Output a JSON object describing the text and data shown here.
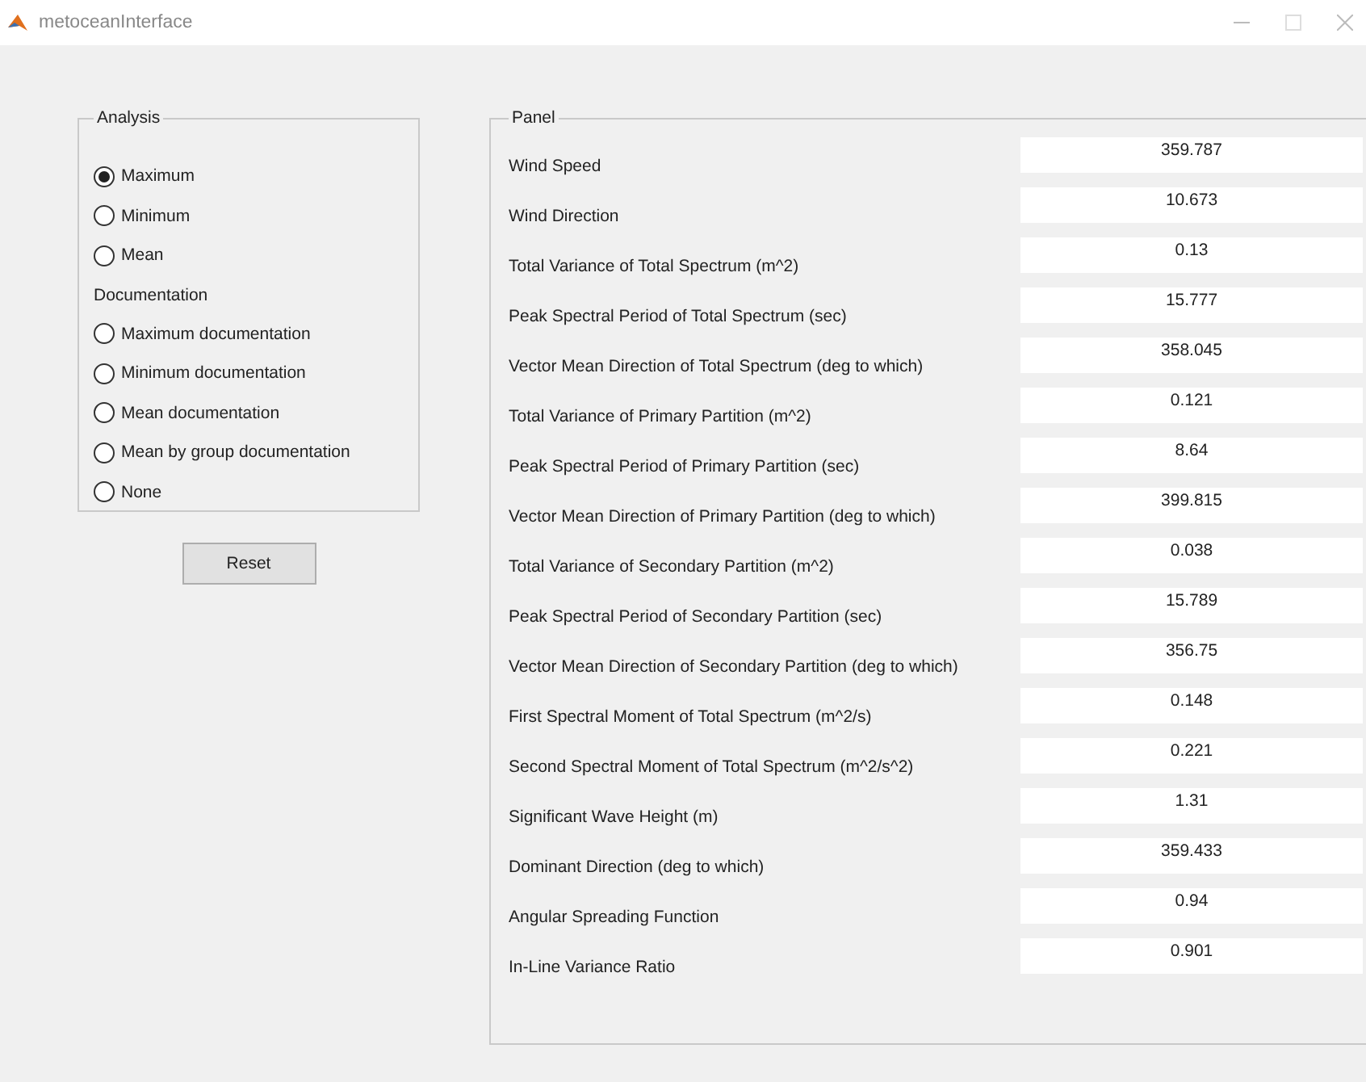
{
  "window": {
    "title": "metoceanInterface"
  },
  "analysis": {
    "title": "Analysis",
    "items": [
      {
        "kind": "radio",
        "label": "Maximum",
        "selected": true
      },
      {
        "kind": "radio",
        "label": "Minimum",
        "selected": false
      },
      {
        "kind": "radio",
        "label": "Mean",
        "selected": false
      },
      {
        "kind": "heading",
        "label": "Documentation"
      },
      {
        "kind": "radio",
        "label": "Maximum documentation",
        "selected": false
      },
      {
        "kind": "radio",
        "label": "Minimum documentation",
        "selected": false
      },
      {
        "kind": "radio",
        "label": "Mean documentation",
        "selected": false
      },
      {
        "kind": "radio",
        "label": "Mean by group documentation",
        "selected": false
      },
      {
        "kind": "radio",
        "label": "None",
        "selected": false
      }
    ]
  },
  "reset_button": "Reset",
  "panel": {
    "title": "Panel",
    "rows": [
      {
        "label": "Wind Speed",
        "value": "359.787"
      },
      {
        "label": "Wind Direction",
        "value": "10.673"
      },
      {
        "label": "Total Variance of Total Spectrum (m^2)",
        "value": "0.13"
      },
      {
        "label": "Peak Spectral Period of Total Spectrum (sec)",
        "value": "15.777"
      },
      {
        "label": "Vector Mean Direction of Total Spectrum (deg to which)",
        "value": "358.045"
      },
      {
        "label": "Total Variance of Primary Partition (m^2)",
        "value": "0.121"
      },
      {
        "label": "Peak Spectral Period of Primary Partition (sec)",
        "value": "8.64"
      },
      {
        "label": "Vector Mean Direction of Primary Partition (deg to which)",
        "value": "399.815"
      },
      {
        "label": "Total Variance of Secondary Partition (m^2)",
        "value": "0.038"
      },
      {
        "label": "Peak Spectral Period of Secondary Partition (sec)",
        "value": "15.789"
      },
      {
        "label": "Vector Mean Direction of Secondary Partition (deg to which)",
        "value": "356.75"
      },
      {
        "label": "First Spectral Moment of Total Spectrum (m^2/s)",
        "value": "0.148"
      },
      {
        "label": "Second Spectral Moment of Total Spectrum (m^2/s^2)",
        "value": "0.221"
      },
      {
        "label": "Significant Wave Height (m)",
        "value": "1.31"
      },
      {
        "label": "Dominant Direction (deg to which)",
        "value": "359.433"
      },
      {
        "label": "Angular Spreading Function",
        "value": "0.94"
      },
      {
        "label": "In-Line Variance Ratio",
        "value": "0.901"
      }
    ]
  }
}
